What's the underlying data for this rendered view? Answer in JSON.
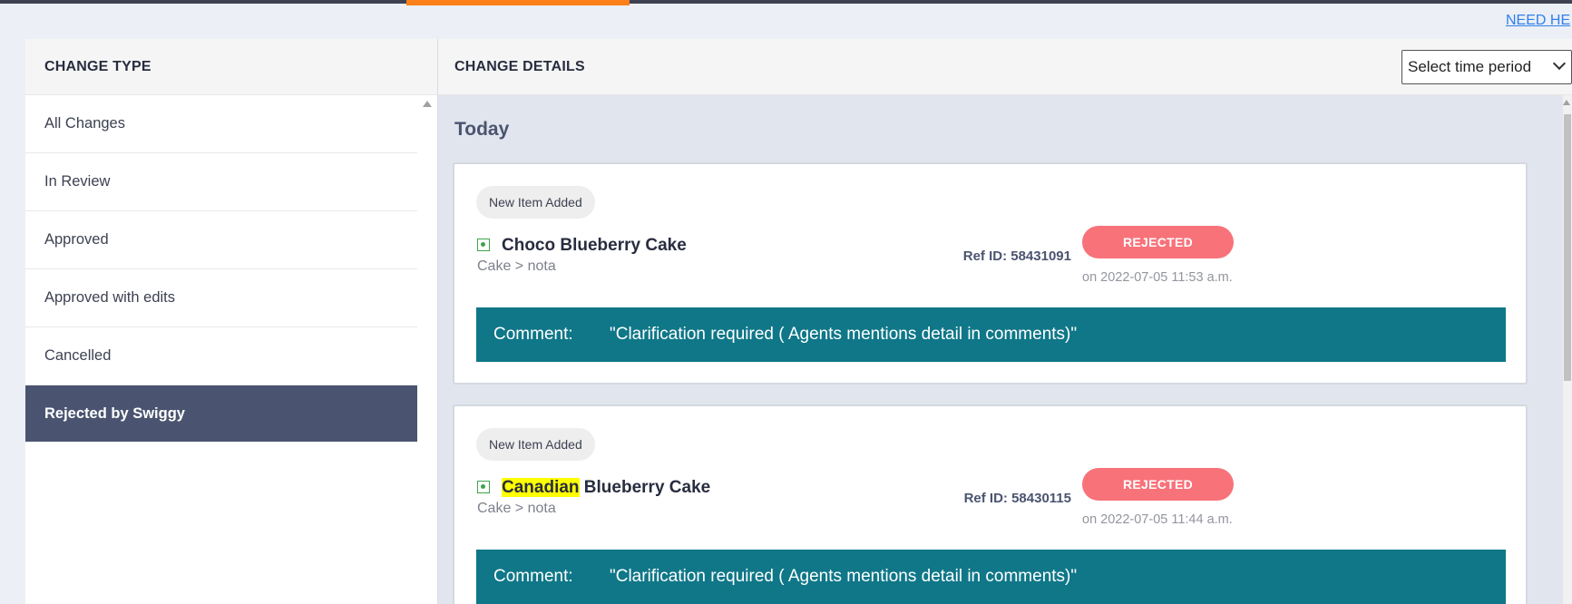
{
  "header": {
    "need_help": "NEED HE"
  },
  "sidebar": {
    "title": "CHANGE TYPE",
    "items": [
      {
        "label": "All Changes"
      },
      {
        "label": "In Review"
      },
      {
        "label": "Approved"
      },
      {
        "label": "Approved with edits"
      },
      {
        "label": "Cancelled"
      },
      {
        "label": "Rejected by Swiggy",
        "active": true
      }
    ]
  },
  "details": {
    "title": "CHANGE DETAILS",
    "time_period_select": {
      "selected": "Select time period"
    },
    "group_title": "Today",
    "cards": [
      {
        "tag": "New Item Added",
        "item_name": "Choco Blueberry Cake",
        "item_path": "Cake > nota",
        "ref_id": "Ref ID: 58431091",
        "status": "REJECTED",
        "status_time": "on 2022-07-05 11:53 a.m.",
        "comment_label": "Comment:",
        "comment_text": "\"Clarification required ( Agents mentions detail in comments)\""
      },
      {
        "tag": "New Item Added",
        "item_name_highlight": "Canadian",
        "item_name_rest": " Blueberry Cake",
        "item_path": "Cake > nota",
        "ref_id": "Ref ID: 58430115",
        "status": "REJECTED",
        "status_time": "on 2022-07-05 11:44 a.m.",
        "comment_label": "Comment:",
        "comment_text": "\"Clarification required ( Agents mentions detail in comments)\""
      }
    ]
  },
  "colors": {
    "accent": "#fc8019",
    "sidebar_active": "#4a5470",
    "rejected": "#f8727a",
    "comment_bar": "#0f7788",
    "veg": "#3fa34d"
  }
}
